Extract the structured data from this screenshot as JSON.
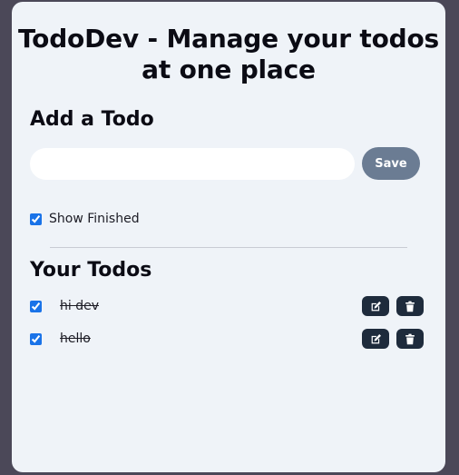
{
  "header": {
    "title": "TodoDev - Manage your todos at one place"
  },
  "add_section": {
    "heading": "Add a Todo",
    "input_value": "",
    "input_placeholder": "",
    "save_label": "Save"
  },
  "filter": {
    "show_finished_label": "Show Finished",
    "show_finished_checked": true
  },
  "todos_section": {
    "heading": "Your Todos",
    "items": [
      {
        "text": "hi dev",
        "completed": true,
        "edit_icon": "edit-icon",
        "delete_icon": "trash-icon"
      },
      {
        "text": "hello",
        "completed": true,
        "edit_icon": "edit-icon",
        "delete_icon": "trash-icon"
      }
    ]
  },
  "colors": {
    "page_background": "#4b4858",
    "card_background": "#eff3f8",
    "save_button": "#6b7c93",
    "action_button": "#1e2b3c",
    "checkbox_accent": "#1a73e8"
  }
}
